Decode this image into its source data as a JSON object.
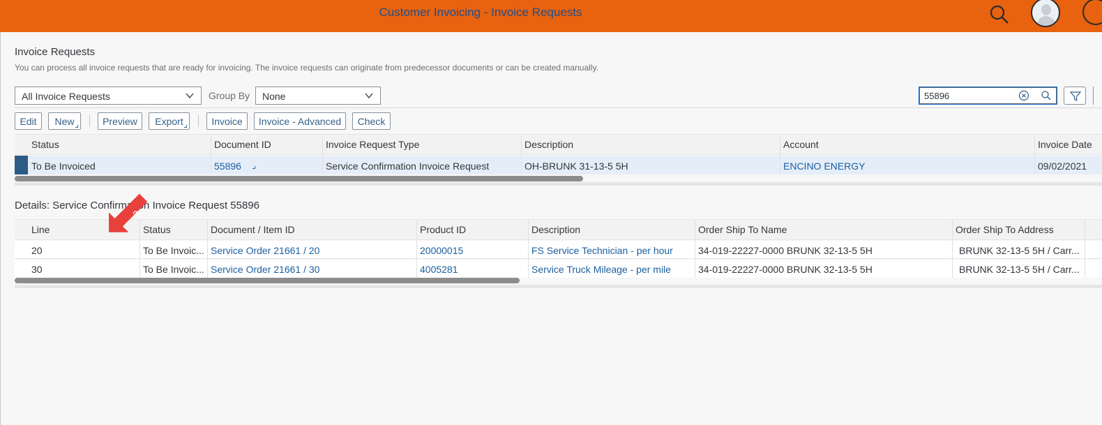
{
  "app": {
    "title": "Customer Invoicing - Invoice Requests",
    "brand_color": "#e8620f",
    "link_color": "#1b5e9f"
  },
  "page": {
    "title": "Invoice Requests",
    "description": "You can process all invoice requests that are ready for invoicing. The invoice requests can originate from predecessor documents or can be created manually."
  },
  "filters": {
    "view_select": "All Invoice Requests",
    "group_by_label": "Group By",
    "group_by_value": "None",
    "search_value": "55896"
  },
  "toolbar": {
    "edit": "Edit",
    "new": "New",
    "preview": "Preview",
    "export": "Export",
    "invoice": "Invoice",
    "invoice_advanced": "Invoice - Advanced",
    "check": "Check"
  },
  "main_table": {
    "headers": [
      "Status",
      "Document ID",
      "Invoice Request Type",
      "Description",
      "Account",
      "Invoice Date"
    ],
    "rows": [
      {
        "status": "To Be Invoiced",
        "document_id": "55896",
        "type": "Service Confirmation Invoice Request",
        "description": "OH-BRUNK 31-13-5 5H",
        "account": "ENCINO ENERGY",
        "invoice_date": "09/02/2021"
      }
    ]
  },
  "details": {
    "title": "Details: Service Confirmation Invoice Request 55896",
    "headers": [
      "Line",
      "Status",
      "Document / Item ID",
      "Product ID",
      "Description",
      "Order Ship To Name",
      "Order Ship To Address"
    ],
    "rows": [
      {
        "line": "20",
        "status": "To Be Invoic...",
        "item_id": "Service Order 21661 / 20",
        "product_id": "20000015",
        "description": "FS Service Technician - per hour",
        "ship_to_name": "34-019-22227-0000 BRUNK 32-13-5 5H",
        "ship_to_address": "BRUNK 32-13-5 5H / Carr..."
      },
      {
        "line": "30",
        "status": "To Be Invoic...",
        "item_id": "Service Order 21661 / 30",
        "product_id": "4005281",
        "description": "Service Truck Mileage - per mile",
        "ship_to_name": "34-019-22227-0000 BRUNK 32-13-5 5H",
        "ship_to_address": "BRUNK 32-13-5 5H / Carr..."
      }
    ]
  },
  "annotation": {
    "arrow_label": "a",
    "arrow_color": "#e8403a"
  }
}
